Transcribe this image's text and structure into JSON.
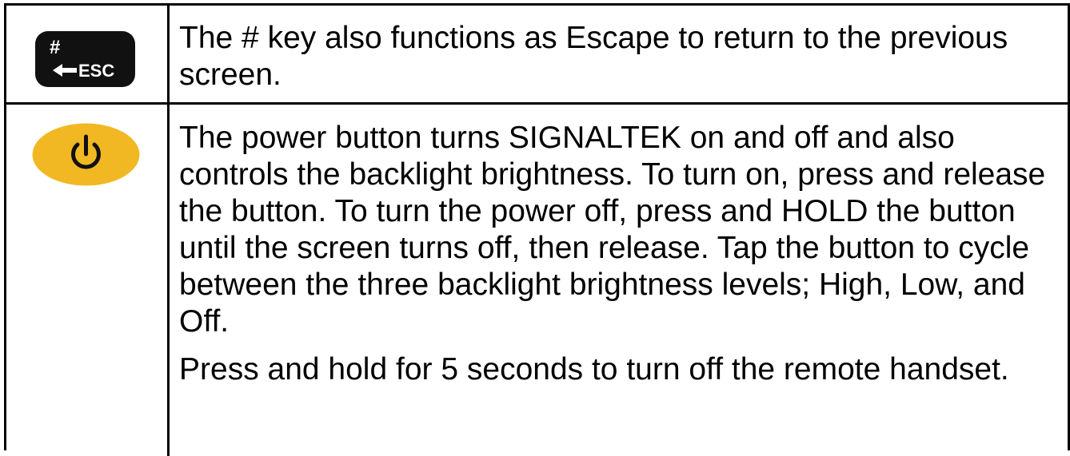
{
  "rows": [
    {
      "icon": {
        "name": "escape-key-icon",
        "hash_glyph": "#",
        "label": "ESC",
        "color": "#111111"
      },
      "text": "The # key also functions as Escape to return to the previous screen."
    },
    {
      "icon": {
        "name": "power-button-icon",
        "color": "#f2b823"
      },
      "paragraphs": [
        "The power button turns SIGNALTEK on and off and also controls the backlight brightness. To turn on, press and release the button. To turn the power off, press and HOLD the button until the screen turns off, then release. Tap the button to cycle between the three backlight brightness levels; High, Low, and Off.",
        "Press and hold for 5 seconds to turn off the remote handset."
      ]
    }
  ]
}
